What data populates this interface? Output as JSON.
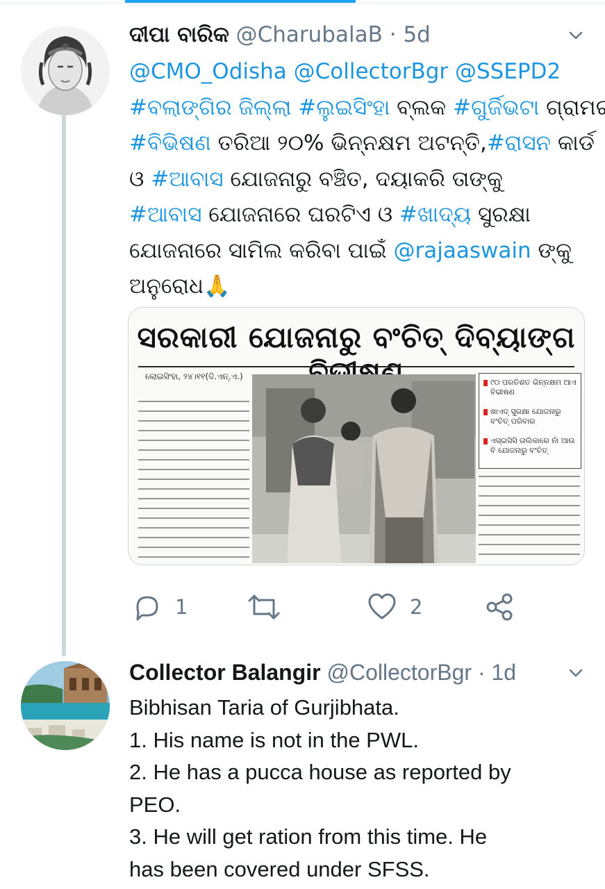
{
  "tweet1": {
    "name": "ଦୀପା ବାରିକ",
    "handle": "@CharubalaB",
    "separator": "·",
    "time": "5d",
    "text_lines": [
      [
        {
          "t": "@CMO_Odisha @CollectorBgr @SSEPD2",
          "link": true
        }
      ],
      [
        {
          "t": "#ବଲାଙ୍ଗିର ଜିଲ୍ଲା",
          "link": true
        },
        {
          "t": " ",
          "link": false
        },
        {
          "t": "#ଲୁଇସିଂହା",
          "link": true
        },
        {
          "t": " ବ୍ଲକ ",
          "link": false
        },
        {
          "t": "#ଗୁର୍ଜିଭଟା",
          "link": true
        },
        {
          "t": " ଗ୍ରାମର",
          "link": false
        }
      ],
      [
        {
          "t": "#ବିଭିଷଣ",
          "link": true
        },
        {
          "t": " ତରିଆ  ୨୦% ଭିନ୍ନକ୍ଷମ ଅଟନ୍ତି,",
          "link": false
        },
        {
          "t": "#ରାସନ",
          "link": true
        },
        {
          "t": " କାର୍ଡ",
          "link": false
        }
      ],
      [
        {
          "t": "ଓ ",
          "link": false
        },
        {
          "t": "#ଆବାସ",
          "link": true
        },
        {
          "t": " ଯୋଜନାରୁ ବଞ୍ଚିତ, ଦୟାକରି ତାଙ୍କୁ",
          "link": false
        }
      ],
      [
        {
          "t": "#ଆବାସ",
          "link": true
        },
        {
          "t": " ଯୋଜନାରେ ଘରଟିଏ ଓ ",
          "link": false
        },
        {
          "t": "#ଖାଦ୍ୟ",
          "link": true
        },
        {
          "t": " ସୁରକ୍ଷା",
          "link": false
        }
      ],
      [
        {
          "t": "ଯୋଜନାରେ ସାମିଲ କରିବା ପାଇଁ ",
          "link": false
        },
        {
          "t": "@rajaaswain",
          "link": true
        },
        {
          "t": " ଙ୍କୁ",
          "link": false
        }
      ],
      [
        {
          "t": "ଅନୁରୋଧ🙏",
          "link": false
        }
      ]
    ],
    "card": {
      "headline": "ସରକାରୀ ଯୋଜନାରୁ ବଂଚିତ୍ ଦିବ୍ୟାଙ୍ଗ ବିଭୀଷଣ",
      "dateline": "ଲୋଇସିଂହା, ୨୪।୧୧(ଦି.ଏନ୍.ଏ.)",
      "box_items": [
        "୯୦ ପରତିଶତ ଭିନ୍ନକ୍ଷମ ଆଏ ବିଭୀଷଣ",
        "ଖାଏଦ୍ ସୁରକ୍ଷା ଯୋଜନାରୁ ବଂଚିତ୍ ପରିବାର",
        "ଏସ୍ଇସିସି ତାଲିକାରେ ନାଁ ଆଉ ବି ଯୋଜନାରୁ ବଂଚିତ୍"
      ]
    },
    "replies": "1",
    "likes": "2"
  },
  "tweet2": {
    "name": "Collector Balangir",
    "handle": "@CollectorBgr",
    "separator": "·",
    "time": "1d",
    "lines": [
      "Bibhisan Taria of Gurjibhata.",
      " 1. His name is not in the PWL.",
      " 2. He has a pucca house as reported by",
      "PEO.",
      " 3. He will get ration from this time. He",
      "has been covered under SFSS."
    ]
  },
  "colors": {
    "link": "#1b95e0",
    "secondary": "#657786",
    "accent_bar": "#1da1f2",
    "thread_line": "#ccd6dd"
  },
  "icons": [
    "chevron-down-icon",
    "reply-icon",
    "retweet-icon",
    "like-icon",
    "share-icon"
  ]
}
